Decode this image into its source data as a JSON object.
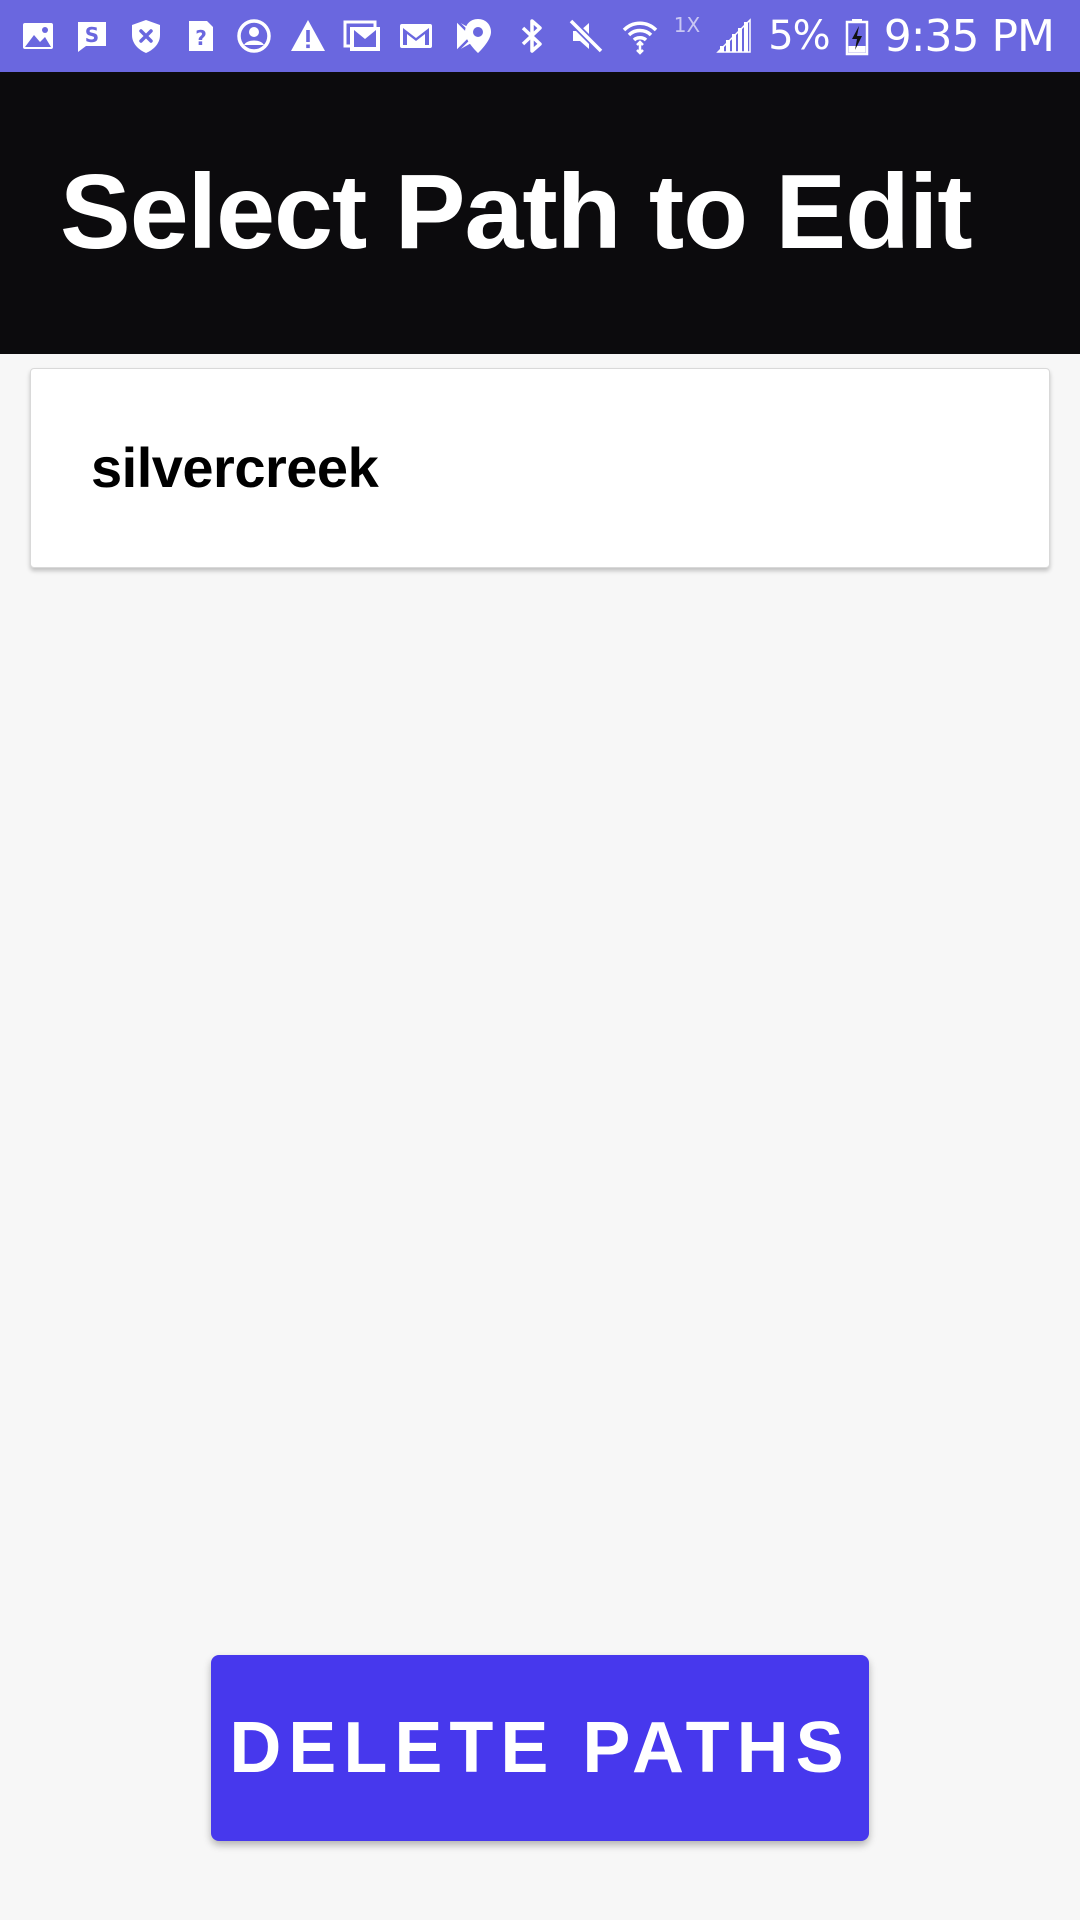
{
  "status_bar": {
    "background": "#6a67df",
    "left_icons": [
      "gallery-icon",
      "s-app-icon",
      "shield-icon",
      "help-icon",
      "account-icon",
      "warning-icon",
      "gallery-mail-icon",
      "gmail-icon",
      "play-store-icon"
    ],
    "right_icons": [
      "location-icon",
      "bluetooth-icon",
      "mute-icon",
      "wifi-icon",
      "signal-icon",
      "battery-charging-icon"
    ],
    "wifi_speed": "1X",
    "battery": "5%",
    "time": "9:35 PM"
  },
  "app_bar": {
    "title": "Select Path to Edit",
    "background": "#0c0b0d"
  },
  "paths": [
    {
      "name": "silvercreek"
    }
  ],
  "actions": {
    "delete_label": "DELETE PATHS",
    "delete_color": "#4738ed"
  }
}
